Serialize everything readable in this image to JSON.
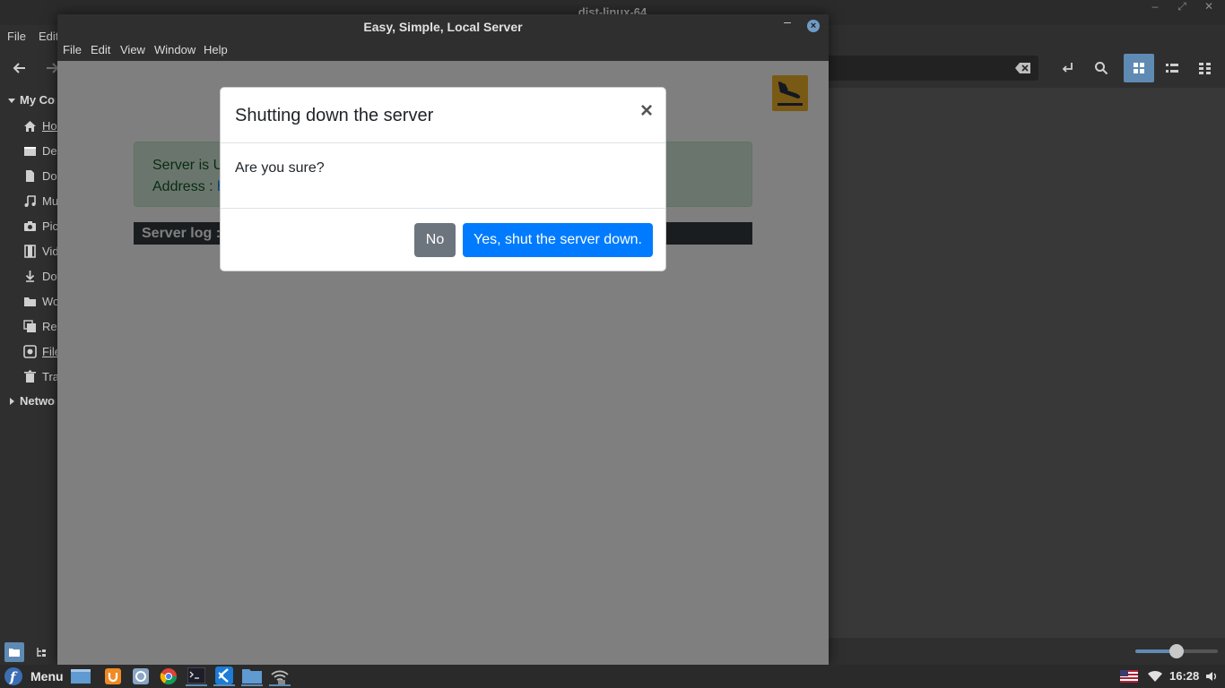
{
  "fm": {
    "title": "dist-linux-64",
    "menu": [
      "File",
      "Edit"
    ],
    "sidebar": {
      "my_computer": "My Computer",
      "items": [
        "Home",
        "Desktop",
        "Documents",
        "Music",
        "Pictures",
        "Videos",
        "Downloads",
        "Work",
        "Recent",
        "File System",
        "Trash"
      ],
      "network": "Network"
    },
    "zoom_level": 0.5
  },
  "app": {
    "title": "Easy, Simple, Local Server",
    "menu": [
      "File",
      "Edit",
      "View",
      "Window",
      "Help"
    ],
    "status": {
      "line1": "Server is U",
      "line2_label": "Address :",
      "line2_link": "h"
    },
    "log_label": "Server log :"
  },
  "modal": {
    "title": "Shutting down the server",
    "close_glyph": "×",
    "body": "Are you sure?",
    "no_label": "No",
    "yes_label": "Yes, shut the server down."
  },
  "taskbar": {
    "menu_label": "Menu",
    "clock": "16:28"
  },
  "colors": {
    "accent": "#5f8ab4",
    "primary": "#007bff",
    "secondary": "#6c757d",
    "success_bg": "#d4edda",
    "logo": "#f0b429"
  },
  "icons": {
    "app_logo": "plane-landing-icon",
    "home": "home-icon",
    "desktop": "desktop-icon",
    "documents": "document-icon",
    "music": "music-note-icon",
    "pictures": "camera-icon",
    "videos": "film-icon",
    "downloads": "download-icon",
    "work": "folder-icon",
    "recent": "recent-icon",
    "filesystem": "drive-icon",
    "trash": "trash-icon"
  }
}
